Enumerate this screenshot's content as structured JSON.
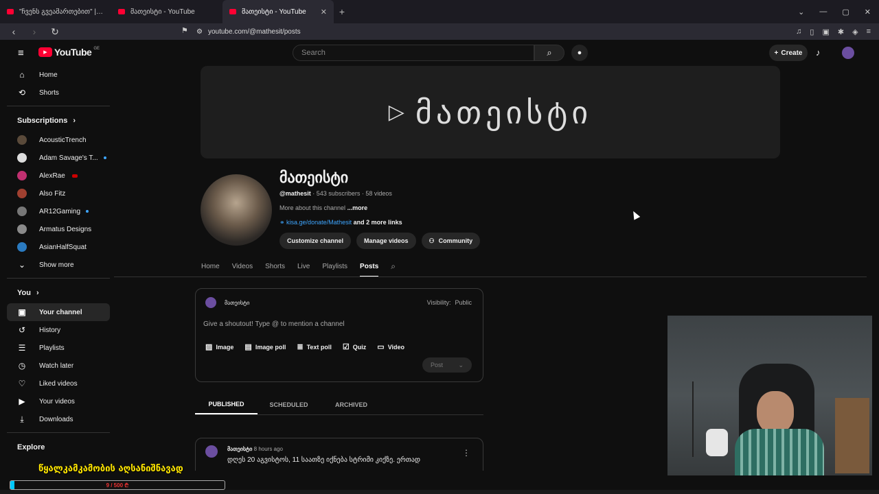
{
  "browser": {
    "tabs": [
      {
        "title": "\"ჩვენს გვეამართებით\" | სულიწმინდა",
        "active": false
      },
      {
        "title": "მათეისტი - YouTube",
        "active": false
      },
      {
        "title": "მათეისტი - YouTube",
        "active": true
      }
    ],
    "url": "youtube.com/@mathesit/posts"
  },
  "yt": {
    "logo": "YouTube",
    "country": "GE",
    "search_placeholder": "Search",
    "create_label": "Create"
  },
  "sidebar": {
    "main": [
      {
        "label": "Home",
        "icon": "home-icon",
        "glyph": "⌂"
      },
      {
        "label": "Shorts",
        "icon": "shorts-icon",
        "glyph": "⟲"
      }
    ],
    "subscriptions_header": "Subscriptions",
    "subscriptions": [
      {
        "label": "AcousticTrench",
        "color": "#5a4a3a"
      },
      {
        "label": "Adam Savage's T...",
        "color": "#dddddd"
      },
      {
        "label": "AlexRae",
        "color": "#c03070"
      },
      {
        "label": "Also Fitz",
        "color": "#a04030"
      },
      {
        "label": "AR12Gaming",
        "color": "#777777"
      },
      {
        "label": "Armatus Designs",
        "color": "#8a8a8a"
      },
      {
        "label": "AsianHalfSquat",
        "color": "#2a7ac0"
      }
    ],
    "show_more": "Show more",
    "you_header": "You",
    "you_items": [
      {
        "label": "Your channel",
        "icon": "your-channel-icon",
        "glyph": "▣"
      },
      {
        "label": "History",
        "icon": "history-icon",
        "glyph": "↺"
      },
      {
        "label": "Playlists",
        "icon": "playlists-icon",
        "glyph": "☰"
      },
      {
        "label": "Watch later",
        "icon": "watch-later-icon",
        "glyph": "◷"
      },
      {
        "label": "Liked videos",
        "icon": "like-icon",
        "glyph": "♡"
      },
      {
        "label": "Your videos",
        "icon": "your-videos-icon",
        "glyph": "▶"
      },
      {
        "label": "Downloads",
        "icon": "download-icon",
        "glyph": "⤓"
      }
    ],
    "explore_header": "Explore"
  },
  "channel": {
    "name": "მათეისტი",
    "handle": "@mathesit",
    "subscribers": " · 543 subscribers · 58 videos",
    "description": "More about this channel",
    "more": " ...more",
    "link": "⚭ kisa.ge/donate/Mathesit",
    "more_links": " and 2 more links",
    "buttons": {
      "customize": "Customize channel",
      "manage": "Manage videos",
      "community": "Community"
    }
  },
  "channel_tabs": [
    {
      "label": "Home",
      "active": false
    },
    {
      "label": "Videos",
      "active": false
    },
    {
      "label": "Shorts",
      "active": false
    },
    {
      "label": "Live",
      "active": false
    },
    {
      "label": "Playlists",
      "active": false
    },
    {
      "label": "Posts",
      "active": true
    }
  ],
  "composer": {
    "author": "მათეისტი",
    "visibility_label": "Visibility:",
    "visibility_value": "Public",
    "placeholder": "Give a shoutout! Type @ to mention a channel",
    "tools": [
      {
        "label": "Image",
        "glyph": "▨",
        "icon": "image-icon"
      },
      {
        "label": "Image poll",
        "glyph": "▤",
        "icon": "image-poll-icon"
      },
      {
        "label": "Text poll",
        "glyph": "≣",
        "icon": "text-poll-icon"
      },
      {
        "label": "Quiz",
        "glyph": "☑",
        "icon": "quiz-icon"
      },
      {
        "label": "Video",
        "glyph": "▭",
        "icon": "video-icon"
      }
    ],
    "post_label": "Post"
  },
  "post_tabs": [
    {
      "label": "PUBLISHED",
      "active": true
    },
    {
      "label": "SCHEDULED",
      "active": false
    },
    {
      "label": "ARCHIVED",
      "active": false
    }
  ],
  "post": {
    "author": "მათეისტი",
    "time": "8 hours ago",
    "text": "დღეს 20 აგვისტოს, 11 საათზე იქნება სტრიმი კიქზე. ერთად"
  },
  "overlay": {
    "text": "წყალკამკამობის აღსანიშნავად",
    "progress_text": "9 / 500 ₾",
    "progress_fraction": 0.018
  },
  "colors": {
    "accent": "#ff0033",
    "link": "#3ea6ff",
    "progress": "#00c8ff",
    "overlay_text": "#ffe600"
  }
}
